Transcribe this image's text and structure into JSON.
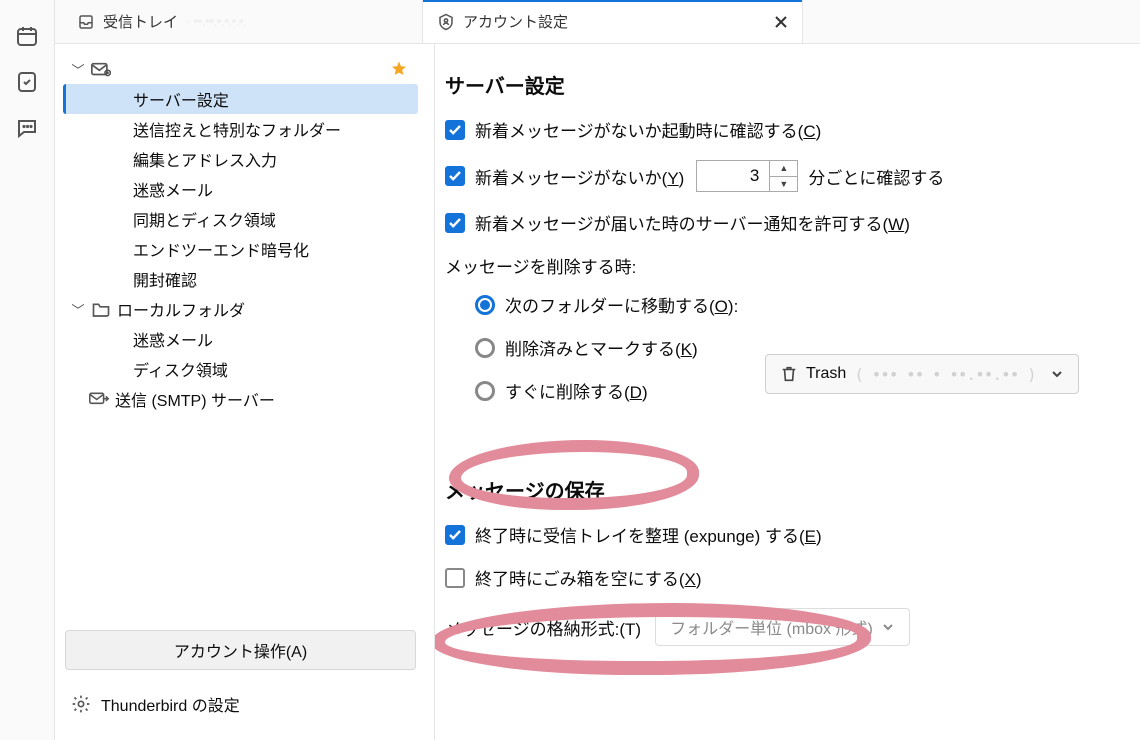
{
  "tabs": {
    "inbox_label": "受信トレイ",
    "account_label": "アカウント設定"
  },
  "sidebar": {
    "items": [
      "サーバー設定",
      "送信控えと特別なフォルダー",
      "編集とアドレス入力",
      "迷惑メール",
      "同期とディスク領域",
      "エンドツーエンド暗号化",
      "開封確認"
    ],
    "local_folder": "ローカルフォルダ",
    "local_items": [
      "迷惑メール",
      "ディスク領域"
    ],
    "smtp": "送信 (SMTP) サーバー",
    "account_actions": "アカウント操作(A)",
    "tb_settings": "Thunderbird の設定"
  },
  "server": {
    "heading": "サーバー設定",
    "check_startup_pre": "新着メッセージがないか起動時に確認する(",
    "check_startup_key": "C",
    "check_every_pre": "新着メッセージがないか(",
    "check_every_key": "Y",
    "check_every_value": "3",
    "check_every_post": "分ごとに確認する",
    "allow_notify_pre": "新着メッセージが届いた時のサーバー通知を許可する(",
    "allow_notify_key": "W",
    "delete_label": "メッセージを削除する時:",
    "radio_move_pre": "次のフォルダーに移動する(",
    "radio_move_key": "O",
    "radio_move_post": "):",
    "radio_mark_pre": "削除済みとマークする(",
    "radio_mark_key": "K",
    "radio_now_pre": "すぐに削除する(",
    "radio_now_key": "D",
    "trash_name": "Trash"
  },
  "storage": {
    "heading": "メッセージの保存",
    "expunge_pre": "終了時に受信トレイを整理 (expunge) する(",
    "expunge_key": "E",
    "empty_trash_pre": "終了時にごみ箱を空にする(",
    "empty_trash_key": "X",
    "format_label": "メッセージの格納形式:(T)",
    "format_value": "フォルダー単位 (mbox 形式)"
  }
}
